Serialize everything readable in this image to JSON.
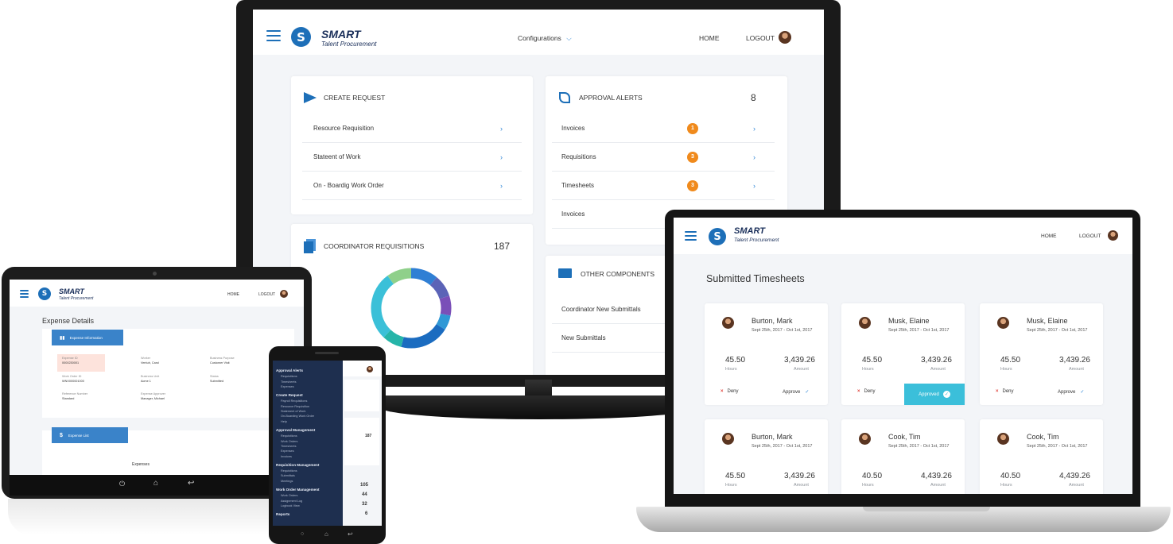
{
  "brand": {
    "name": "SMART",
    "tagline": "Talent Procurement"
  },
  "desktop": {
    "nav": {
      "configurations": "Configurations",
      "home": "HOME",
      "logout": "LOGOUT"
    },
    "create_request": {
      "title": "CREATE REQUEST",
      "items": [
        "Resource Requisition",
        "Stateent of Work",
        "On - Boardig Work Order"
      ]
    },
    "approval_alerts": {
      "title": "APPROVAL ALERTS",
      "count": "8",
      "items": [
        {
          "label": "Invoices",
          "badge": "1"
        },
        {
          "label": "Requisitions",
          "badge": "3"
        },
        {
          "label": "Timesheets",
          "badge": "3"
        },
        {
          "label": "Invoices",
          "badge": ""
        }
      ]
    },
    "coordinator": {
      "title": "COORDINATOR REQUISITIONS",
      "count": "187"
    },
    "other": {
      "title": "OTHER COMPONENTS",
      "items": [
        "Coordinator New Submittals",
        "New Submittals"
      ]
    }
  },
  "laptop": {
    "nav": {
      "home": "HOME",
      "logout": "LOGOUT"
    },
    "page_title": "Submitted Timesheets",
    "cards": [
      {
        "name": "Burton, Mark",
        "date": "Sept 25th, 2017 - Oct 1st, 2017",
        "hours": "45.50",
        "hours_label": "Hours",
        "amount": "3,439.26",
        "amount_label": "Amount",
        "deny": "Deny",
        "approve": "Approve"
      },
      {
        "name": "Musk, Elaine",
        "date": "Sept 25th, 2017 - Oct 1st, 2017",
        "hours": "45.50",
        "hours_label": "Hours",
        "amount": "3,439.26",
        "amount_label": "Amount",
        "deny": "Deny",
        "approve": "Approved"
      },
      {
        "name": "Musk, Elaine",
        "date": "Sept 25th, 2017 - Oct 1st, 2017",
        "hours": "45.50",
        "hours_label": "Hours",
        "amount": "3,439.26",
        "amount_label": "Amount",
        "deny": "Deny",
        "approve": "Approve"
      },
      {
        "name": "Burton, Mark",
        "date": "Sept 25th, 2017 - Oct 1st, 2017",
        "hours": "45.50",
        "hours_label": "Hours",
        "amount": "3,439.26",
        "amount_label": "Amount"
      },
      {
        "name": "Cook, Tim",
        "date": "Sept 25th, 2017 - Oct 1st, 2017",
        "hours": "40.50",
        "hours_label": "Hours",
        "amount": "4,439.26",
        "amount_label": "Amount"
      },
      {
        "name": "Cook, Tim",
        "date": "Sept 25th, 2017 - Oct 1st, 2017",
        "hours": "40.50",
        "hours_label": "Hours",
        "amount": "4,439.26",
        "amount_label": "Amount"
      }
    ]
  },
  "tablet": {
    "nav": {
      "home": "HOME",
      "logout": "LOGOUT"
    },
    "page_title": "Expense Details",
    "info_button": "Expense Information",
    "fields": [
      {
        "label": "Expense ID",
        "value": "0000230001"
      },
      {
        "label": "Worker",
        "value": "Ventuh, Carol"
      },
      {
        "label": "Business Purpose",
        "value": "Customer Visit"
      },
      {
        "label": "Work Order ID",
        "value": "WNX000001000"
      },
      {
        "label": "Business Unit",
        "value": "Acme 1"
      },
      {
        "label": "Status",
        "value": "Submitted"
      },
      {
        "label": "Reference Number",
        "value": "Standard"
      },
      {
        "label": "Expense Approver",
        "value": "Manager, Michael"
      }
    ],
    "list_button": "Expense List",
    "expenses_label": "Expenses"
  },
  "phone": {
    "sections": [
      {
        "title": "Approval Alerts",
        "items": [
          "Requisitions",
          "Timesheets",
          "Expenses"
        ]
      },
      {
        "title": "Create Request",
        "items": [
          "Payroll Requisitions",
          "Resource Requisition",
          "Statement of Work",
          "On-Boarding Work Order",
          "Help"
        ]
      },
      {
        "title": "Approval Management",
        "items": [
          "Requisitions",
          "Work Orders",
          "Timesheets",
          "Expenses",
          "Invoices"
        ]
      },
      {
        "title": "Requisition Management",
        "items": [
          "Requisitions",
          "Submittals",
          "Meetings"
        ]
      },
      {
        "title": "Work Order Management",
        "items": [
          "Work Orders",
          "Assignment Log",
          "Logbook View"
        ]
      },
      {
        "title": "Reports",
        "items": []
      }
    ],
    "numbers": [
      "187",
      "105",
      "44",
      "32",
      "6"
    ]
  },
  "colors": {
    "accent": "#1d6fb8",
    "orange": "#f08a1c",
    "cyan": "#3bbfda",
    "navy": "#1e2f4f"
  },
  "donut_chart": {
    "type": "pie",
    "values": [
      11,
      9,
      8,
      6,
      20,
      8,
      28,
      10
    ],
    "colors": [
      "#2f7fd4",
      "#5b63b7",
      "#7a4fb8",
      "#2f98d6",
      "#1b6cc0",
      "#26b5a9",
      "#3bc0d8",
      "#8fd08a"
    ]
  }
}
